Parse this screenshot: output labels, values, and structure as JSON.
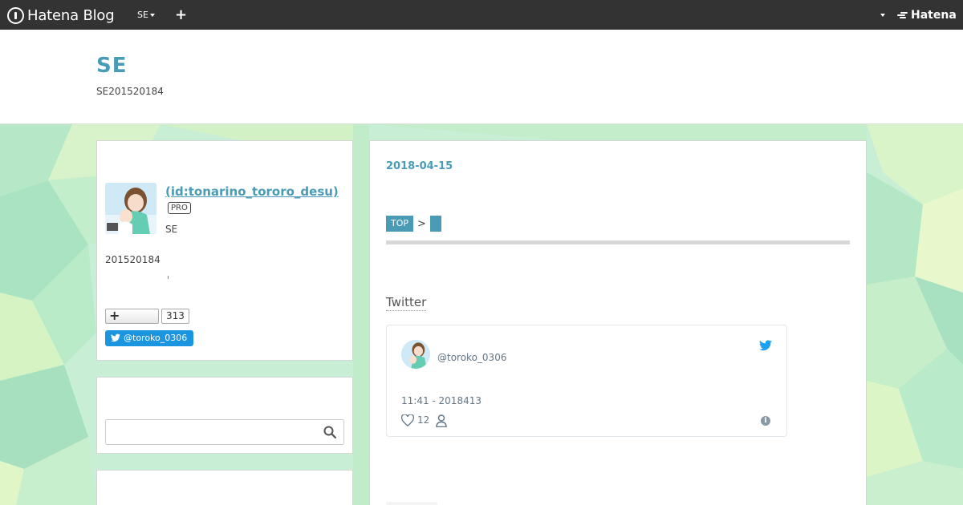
{
  "topbar": {
    "logo_text": "Hatena Blog",
    "blog_menu_label": "SE",
    "add_icon": "plus-icon",
    "brand_text": "Hatena"
  },
  "blog": {
    "title": "SE",
    "description": "SE201520184"
  },
  "profile": {
    "name": " (id:tonarino_tororo_desu)",
    "badge": "PRO",
    "tagline": "SE",
    "bio": "201520184",
    "reader_count": "313",
    "twitter_button": "@toroko_0306"
  },
  "search": {
    "placeholder": ""
  },
  "entry": {
    "date": "2018-04-15",
    "breadcrumb_top": "TOP",
    "breadcrumb_separator": ">",
    "section_heading": "Twitter"
  },
  "tweet": {
    "handle": "@toroko_0306",
    "time": "11:41 - 2018413",
    "likes": "12"
  },
  "colors": {
    "accent": "#4a9bb5",
    "topbar": "#333333",
    "twitter_blue": "#1b95e0"
  }
}
